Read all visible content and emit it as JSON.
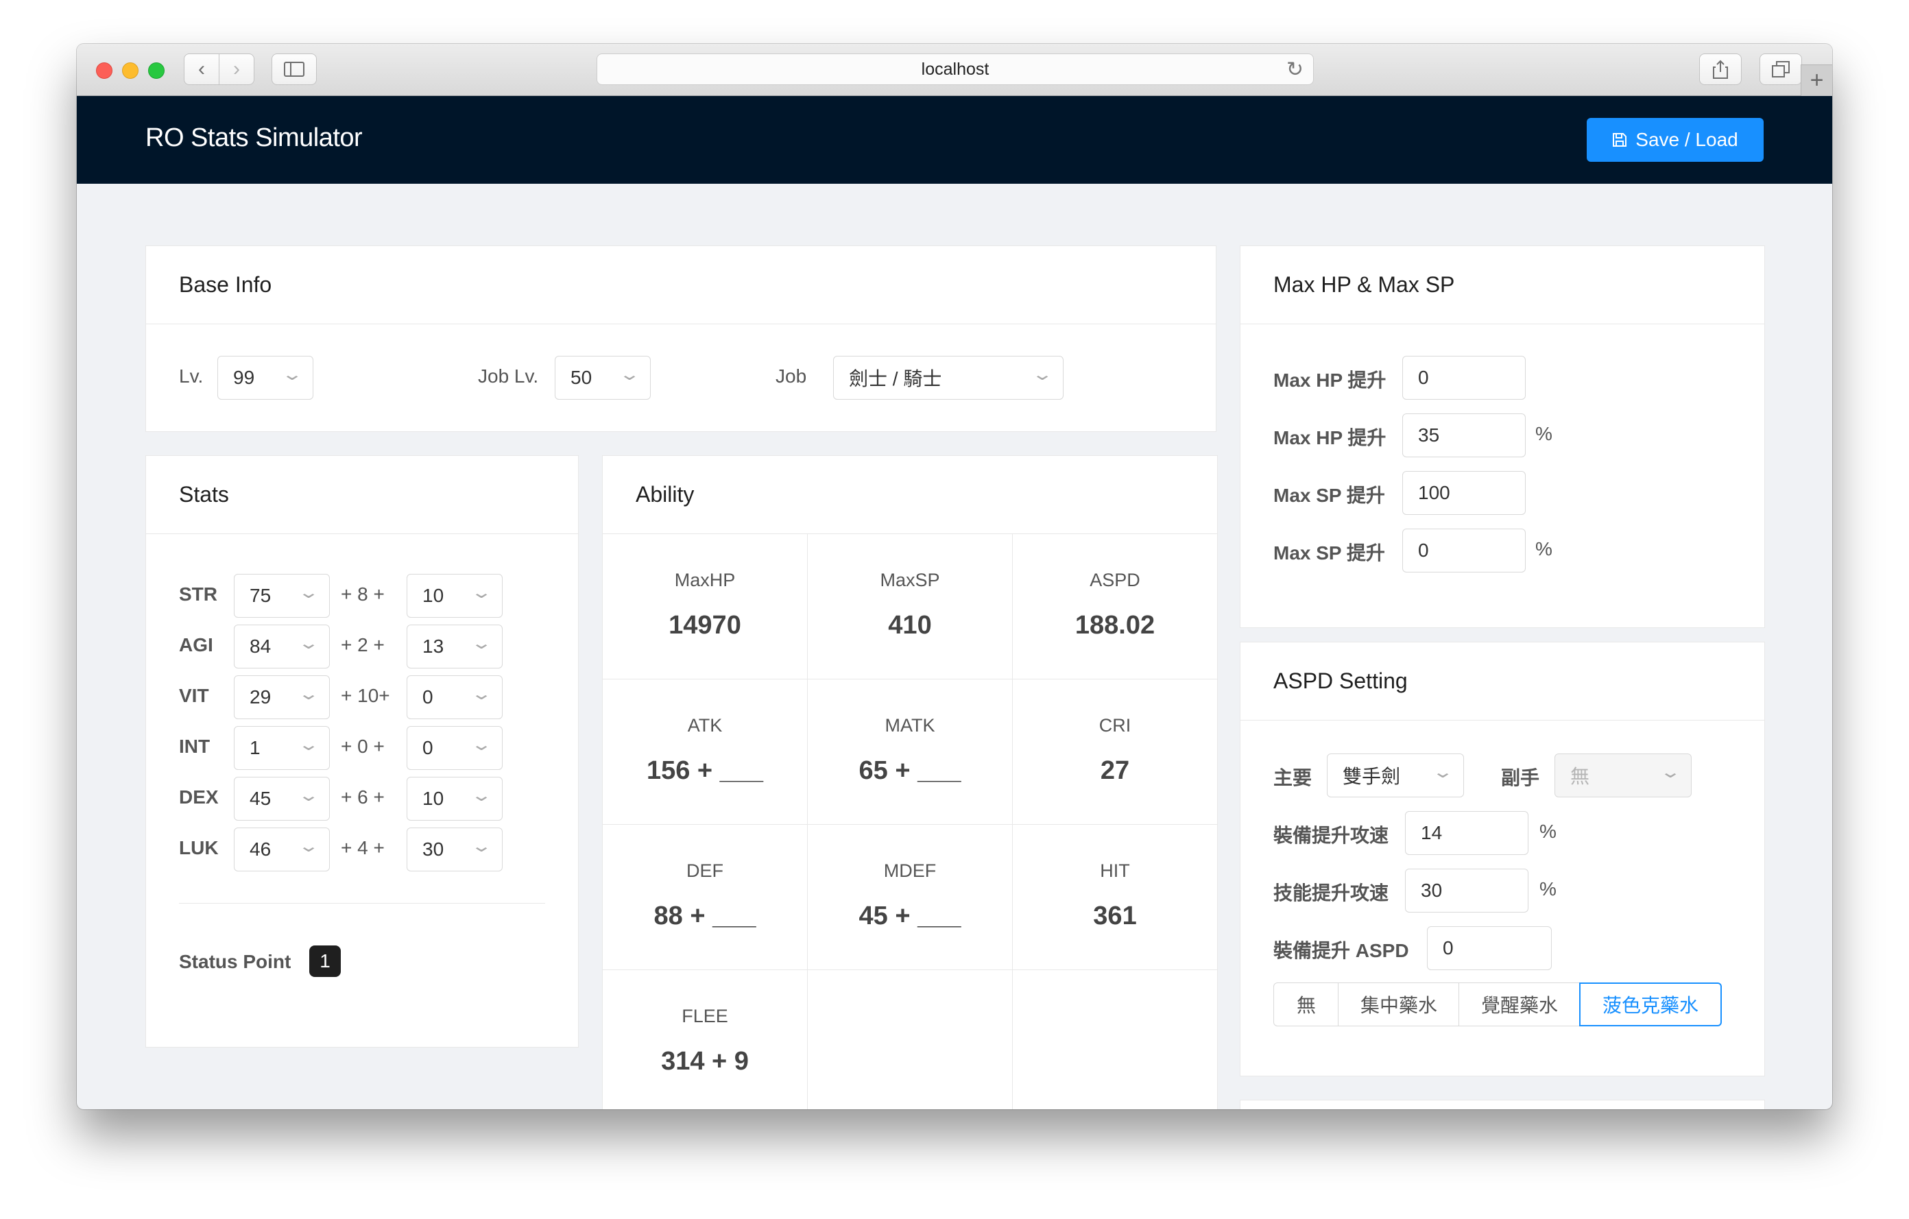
{
  "browser": {
    "url": "localhost"
  },
  "header": {
    "title": "RO Stats Simulator",
    "save_label": "Save / Load"
  },
  "base_info": {
    "title": "Base Info",
    "lv_label": "Lv.",
    "lv_value": "99",
    "job_lv_label": "Job Lv.",
    "job_lv_value": "50",
    "job_label": "Job",
    "job_value": "劍士 / 騎士"
  },
  "stats": {
    "title": "Stats",
    "rows": [
      {
        "name": "STR",
        "base": "75",
        "bonus": "+ 8 +",
        "extra": "10"
      },
      {
        "name": "AGI",
        "base": "84",
        "bonus": "+ 2 +",
        "extra": "13"
      },
      {
        "name": "VIT",
        "base": "29",
        "bonus": "+ 10+",
        "extra": "0"
      },
      {
        "name": "INT",
        "base": "1",
        "bonus": "+ 0 +",
        "extra": "0"
      },
      {
        "name": "DEX",
        "base": "45",
        "bonus": "+ 6 +",
        "extra": "10"
      },
      {
        "name": "LUK",
        "base": "46",
        "bonus": "+ 4 +",
        "extra": "30"
      }
    ],
    "status_point_label": "Status Point",
    "status_point_value": "1"
  },
  "ability": {
    "title": "Ability",
    "cells": [
      {
        "label": "MaxHP",
        "value": "14970"
      },
      {
        "label": "MaxSP",
        "value": "410"
      },
      {
        "label": "ASPD",
        "value": "188.02"
      },
      {
        "label": "ATK",
        "value": "156 + ___"
      },
      {
        "label": "MATK",
        "value": "65 + ___"
      },
      {
        "label": "CRI",
        "value": "27"
      },
      {
        "label": "DEF",
        "value": "88 + ___"
      },
      {
        "label": "MDEF",
        "value": "45 + ___"
      },
      {
        "label": "HIT",
        "value": "361"
      },
      {
        "label": "FLEE",
        "value": "314 + 9"
      }
    ]
  },
  "max_hp_sp": {
    "title": "Max HP & Max SP",
    "rows": [
      {
        "label": "Max HP 提升",
        "value": "0",
        "unit": ""
      },
      {
        "label": "Max HP 提升",
        "value": "35",
        "unit": "%"
      },
      {
        "label": "Max SP 提升",
        "value": "100",
        "unit": ""
      },
      {
        "label": "Max SP 提升",
        "value": "0",
        "unit": "%"
      }
    ]
  },
  "aspd_setting": {
    "title": "ASPD Setting",
    "main_label": "主要",
    "main_value": "雙手劍",
    "offhand_label": "副手",
    "offhand_value": "無",
    "equip_speed_label": "裝備提升攻速",
    "equip_speed_value": "14",
    "skill_speed_label": "技能提升攻速",
    "skill_speed_value": "30",
    "equip_aspd_label": "裝備提升 ASPD",
    "equip_aspd_value": "0",
    "percent": "%",
    "potions": [
      "無",
      "集中藥水",
      "覺醒藥水",
      "菠色克藥水"
    ],
    "selected_potion": "菠色克藥水"
  },
  "colors": {
    "header_bg": "#001529",
    "accent": "#1890ff",
    "page_bg": "#f0f2f5"
  }
}
